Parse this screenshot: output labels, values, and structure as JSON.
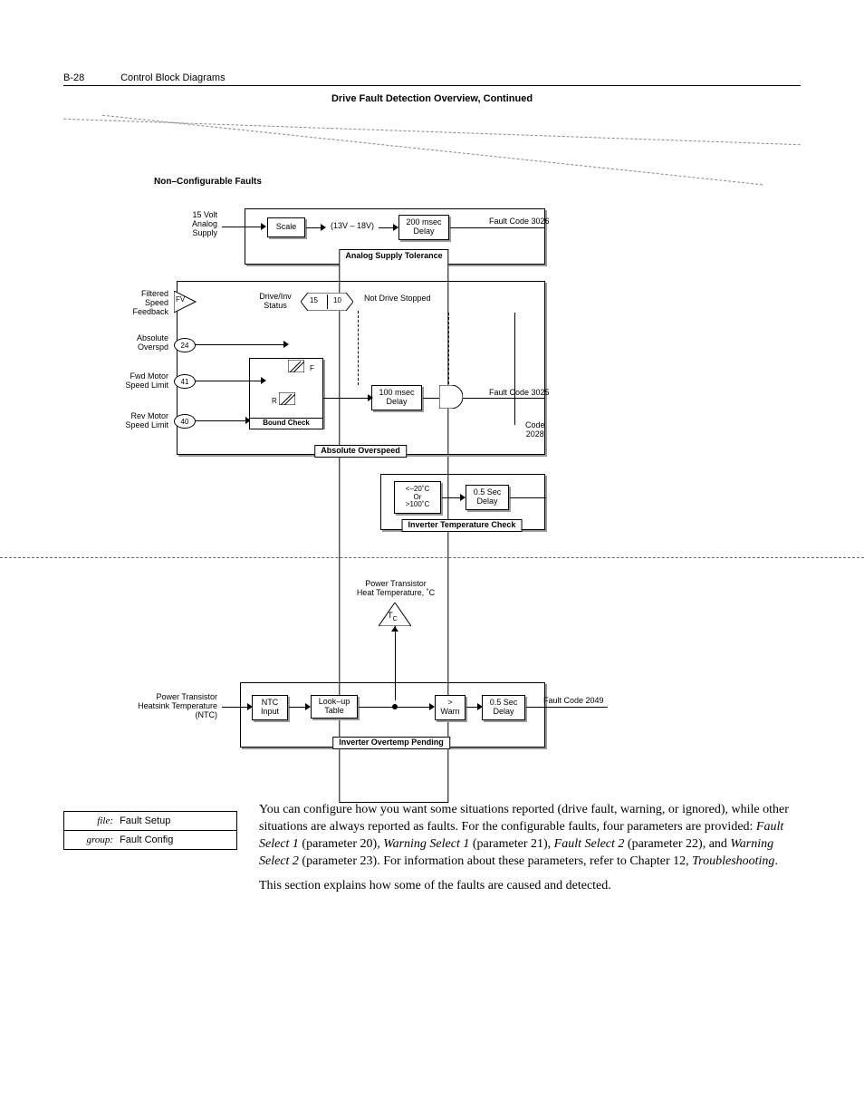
{
  "header": {
    "page_num": "B-28",
    "section": "Control Block Diagrams"
  },
  "figure_title": "Drive Fault Detection Overview, Continued",
  "section_heading": "Non–Configurable Faults",
  "analog": {
    "input": "15 Volt\nAnalog\nSupply",
    "scale": "Scale",
    "range": "(13V – 18V)",
    "delay": "200 msec\nDelay",
    "fault": "Fault Code 3026",
    "group": "Analog Supply Tolerance"
  },
  "overspeed": {
    "fsf": "Filtered\nSpeed\nFeedback",
    "fv": "FV",
    "drive_status": "Drive/Inv\nStatus",
    "bit15": "15",
    "bit10": "10",
    "not_stopped": "Not Drive Stopped",
    "abs": "Absolute\nOverspd",
    "abs_p": "24",
    "fwd": "Fwd Motor\nSpeed Limit",
    "fwd_p": "41",
    "rev": "Rev Motor\nSpeed Limit",
    "rev_p": "40",
    "f": "F",
    "r": "R",
    "delay": "100 msec\nDelay",
    "bound": "Bound Check",
    "group": "Absolute Overspeed",
    "fault": "Fault Code 3025",
    "code": "Code\n2028"
  },
  "temp": {
    "cond": "<–20˚C\nOr\n>100˚C",
    "delay": "0.5 Sec\nDelay",
    "group": "Inverter Temperature Check"
  },
  "pend": {
    "heat_label": "Power Transistor\nHeat Temperature, ˚C",
    "tc": "T",
    "tc_sub": "C",
    "ntc_label": "Power Transistor\nHeatsink Temperature\n(NTC)",
    "ntc": "NTC\nInput",
    "lookup": "Look–up\nTable",
    "warn": ">\nWarn",
    "delay": "0.5 Sec\nDelay",
    "fault": "Fault Code 2049",
    "group": "Inverter Overtemp Pending"
  },
  "file_box": {
    "file_key": "file:",
    "file_val": "Fault Setup",
    "group_key": "group:",
    "group_val": "Fault Config"
  },
  "body": {
    "p1a": "You can configure how you want some situations reported (drive fault, warning, or ignored), while other situations are always reported as faults. For the configurable faults, four parameters are provided: ",
    "i1": "Fault Select 1",
    "p1b": " (parameter 20), ",
    "i2": "Warning Select 1",
    "p1c": " (parameter 21), ",
    "i3": "Fault Select 2",
    "p1d": " (parameter 22), and ",
    "i4": "Warning Select 2",
    "p1e": " (parameter 23). For information about these parameters, refer to Chapter 12, ",
    "i5": "Troubleshooting",
    "p1f": ".",
    "p2": "This section explains how some of the faults are caused and detected."
  }
}
